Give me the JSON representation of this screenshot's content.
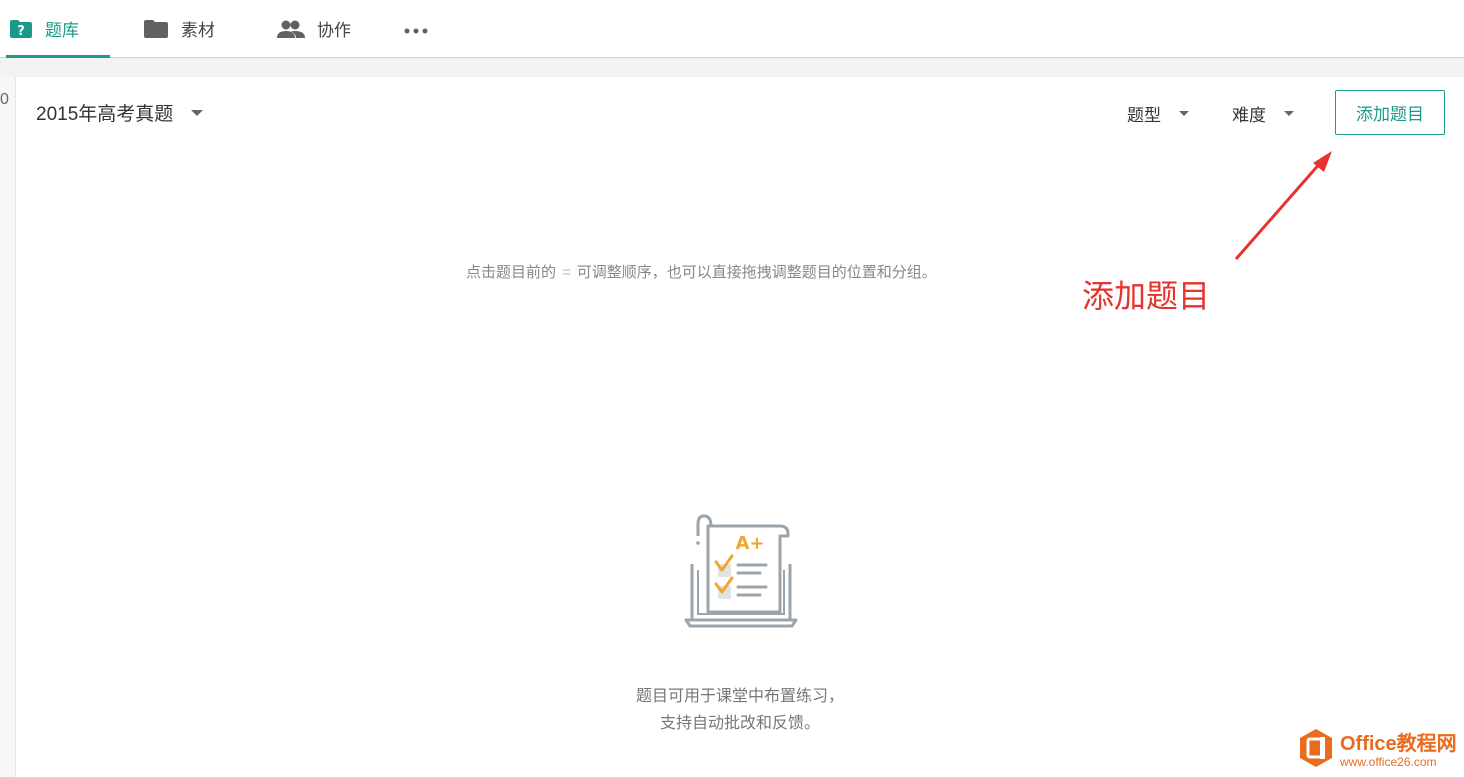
{
  "tabs": [
    {
      "label": "题库",
      "icon": "question-folder-icon",
      "active": true
    },
    {
      "label": "素材",
      "icon": "folder-icon"
    },
    {
      "label": "协作",
      "icon": "people-icon"
    },
    {
      "label": "",
      "icon": "more-dots-icon"
    }
  ],
  "left_strip": {
    "edge_text": "0"
  },
  "toolbar": {
    "bank_name": "2015年高考真题",
    "filter_type": "题型",
    "filter_difficulty": "难度",
    "add_button": "添加题目"
  },
  "hint": {
    "before": "点击题目前的",
    "symbol": "=",
    "after": "可调整顺序，也可以直接拖拽调整题目的位置和分组。"
  },
  "annotation": {
    "text": "添加题目",
    "color": "#e8322d"
  },
  "empty_state": {
    "line1": "题目可用于课堂中布置练习，",
    "line2": "支持自动批改和反馈。",
    "illustration": "grade-paper-icon",
    "grade": "A+"
  },
  "watermark": {
    "line1": "Office教程网",
    "line2": "www.office26.com"
  },
  "colors": {
    "accent": "#1a9b8a",
    "annotation": "#e8322d",
    "watermark": "#e86b1e"
  }
}
